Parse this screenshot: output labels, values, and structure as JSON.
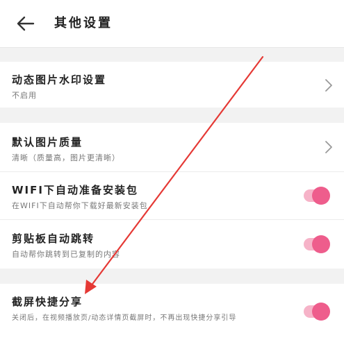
{
  "header": {
    "title": "其他设置"
  },
  "settings": [
    {
      "label": "动态图片水印设置",
      "sub": "不启用"
    },
    {
      "label": "默认图片质量",
      "sub": "清晰（质量高，图片更清晰）"
    },
    {
      "label": "WIFI下自动准备安装包",
      "sub": "在WIFI下自动帮你下载好最新安装包"
    },
    {
      "label": "剪贴板自动跳转",
      "sub": "自动帮你跳转到已复制的内容"
    },
    {
      "label": "截屏快捷分享",
      "sub": "关闭后，在视频播放页/动态详情页截屏时，不再出现快捷分享引导"
    }
  ],
  "colors": {
    "accent": "#ee5d8c",
    "accent_track": "#f6b3c8",
    "annotation": "#e53935"
  },
  "icons": {
    "back": "arrow-left-icon",
    "chevron": "chevron-right-icon"
  }
}
